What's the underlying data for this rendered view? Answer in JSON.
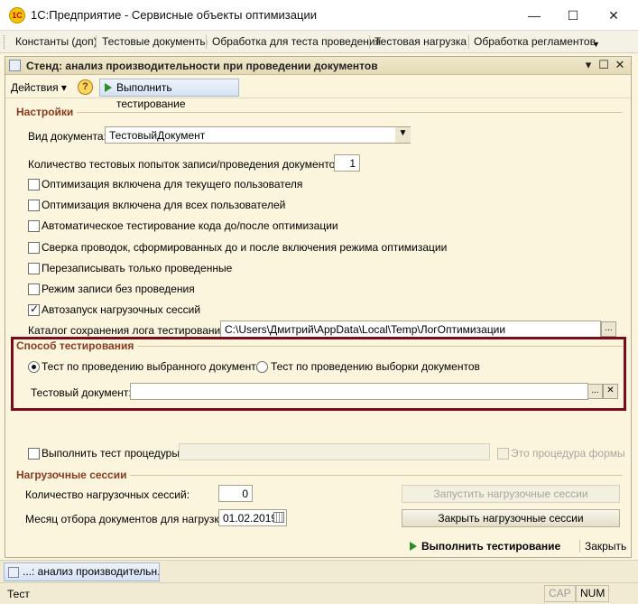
{
  "app": {
    "title": "1С:Предприятие - Сервисные объекты оптимизации",
    "logo_text": "1С"
  },
  "window_controls": {
    "minimize": "—",
    "maximize": "☐",
    "close": "✕"
  },
  "menubar": {
    "items": [
      "Константы (доп)",
      "Тестовые документы",
      "Обработка для теста проведения",
      "Тестовая нагрузка",
      "Обработка регламентов"
    ],
    "more_icon": "▼"
  },
  "form": {
    "title": "Стенд: анализ производительности при проведении документов",
    "controls": {
      "menu": "▾",
      "maximize": "☐",
      "close": "✕"
    },
    "toolbar": {
      "actions": "Действия ▾",
      "help": "?",
      "run": "Выполнить тестирование"
    },
    "settings": {
      "title": "Настройки",
      "doc_type_label": "Вид документа:",
      "doc_type_value": "ТестовыйДокумент",
      "attempts_label": "Количество тестовых попыток записи/проведения документов:",
      "attempts_value": "1",
      "options": [
        {
          "label": "Оптимизация включена для текущего пользователя",
          "checked": false
        },
        {
          "label": "Оптимизация включена для всех пользователей",
          "checked": false
        },
        {
          "label": "Автоматическое тестирование кода до/после оптимизации",
          "checked": false
        },
        {
          "label": "Сверка проводок, сформированных до и после включения режима оптимизации",
          "checked": false
        },
        {
          "label": "Перезаписывать только проведенные",
          "checked": false
        },
        {
          "label": "Режим записи без проведения",
          "checked": false
        },
        {
          "label": "Автозапуск нагрузочных сессий",
          "checked": true
        }
      ],
      "log_dir_label": "Каталог сохранения лога тестирования:",
      "log_dir_value": "C:\\Users\\Дмитрий\\AppData\\Local\\Temp\\ЛогОптимизации",
      "browse": "..."
    },
    "test_mode": {
      "title": "Способ тестирования",
      "option_selected": "Тест по проведению выбранного документа",
      "option_other": "Тест по проведению выборки документов",
      "test_doc_label": "Тестовый документ:",
      "test_doc_value": "",
      "browse": "...",
      "clear": "✕"
    },
    "procedure": {
      "label": "Выполнить тест процедуры:",
      "value": "",
      "form_proc_label": "Это процедура формы"
    },
    "load": {
      "title": "Нагрузочные сессии",
      "sessions_label": "Количество нагрузочных сессий:",
      "sessions_value": "0",
      "month_label": "Месяц отбора документов для нагрузки:",
      "month_value": "01.02.2019",
      "start_button": "Запустить нагрузочные сессии",
      "close_button": "Закрыть нагрузочные сессии"
    },
    "footer": {
      "run": "Выполнить тестирование",
      "close": "Закрыть"
    }
  },
  "taskbar": {
    "task": "...: анализ производительн..."
  },
  "status": {
    "text": "Тест",
    "cap": "CAP",
    "num": "NUM"
  }
}
